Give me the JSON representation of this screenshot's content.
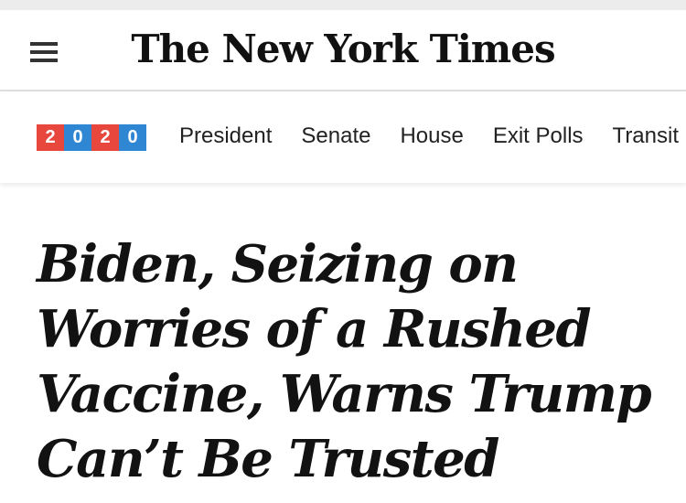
{
  "masthead": {
    "title": "The New York Times",
    "menu_icon": "hamburger-menu-icon"
  },
  "election_nav": {
    "badge_digits": [
      {
        "digit": "2",
        "color": "#e8473d"
      },
      {
        "digit": "0",
        "color": "#2f86d2"
      },
      {
        "digit": "2",
        "color": "#e8473d"
      },
      {
        "digit": "0",
        "color": "#2f86d2"
      }
    ],
    "links": [
      "President",
      "Senate",
      "House",
      "Exit Polls",
      "Transit"
    ]
  },
  "article": {
    "headline": "Biden, Seizing on Worries of a Rushed Vaccine, Warns Trump Can’t Be Trusted"
  }
}
